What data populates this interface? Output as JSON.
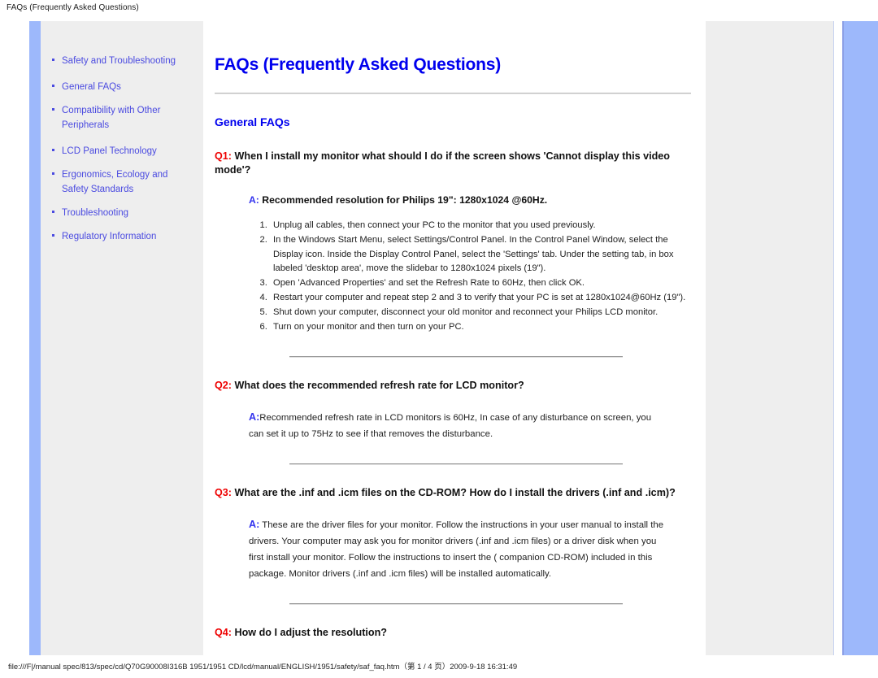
{
  "window": {
    "title": "FAQs (Frequently Asked Questions)"
  },
  "sidebar": {
    "items": [
      {
        "label": "Safety and Troubleshooting"
      },
      {
        "label": "General FAQs"
      },
      {
        "label": "Compatibility with Other Peripherals"
      },
      {
        "label": "LCD Panel Technology"
      },
      {
        "label": "Ergonomics, Ecology and Safety Standards"
      },
      {
        "label": "Troubleshooting"
      },
      {
        "label": "Regulatory Information"
      }
    ]
  },
  "main": {
    "page_title": "FAQs (Frequently Asked Questions)",
    "section_title": "General FAQs",
    "questions": [
      {
        "tag": "Q1:",
        "text": "When I install my monitor what should I do if the screen shows 'Cannot display this video mode'?",
        "answer_tag": "A:",
        "answer_head": "Recommended resolution for Philips 19\": 1280x1024 @60Hz.",
        "steps": [
          "Unplug all cables, then connect your PC to the monitor that you used previously.",
          "In the Windows Start Menu, select Settings/Control Panel. In the Control Panel Window, select the Display icon. Inside the Display Control Panel, select the 'Settings' tab. Under the setting tab, in box labeled 'desktop area', move the slidebar to 1280x1024 pixels (19\").",
          "Open 'Advanced Properties' and set the Refresh Rate to 60Hz, then click OK.",
          "Restart your computer and repeat step 2 and 3 to verify that your PC is set at 1280x1024@60Hz (19\").",
          "Shut down your computer, disconnect your old monitor and reconnect your Philips LCD monitor.",
          "Turn on your monitor and then turn on your PC."
        ]
      },
      {
        "tag": "Q2:",
        "text": "What does the recommended refresh rate for LCD monitor?",
        "answer_tag": "A:",
        "answer_body": "Recommended refresh rate in LCD monitors is 60Hz, In case of any disturbance on screen, you can set it up to 75Hz to see if that removes the disturbance."
      },
      {
        "tag": "Q3:",
        "text": "What are the .inf and .icm files on the CD-ROM? How do I install the drivers (.inf and .icm)?",
        "answer_tag": "A:",
        "answer_body": "These are the driver files for your monitor. Follow the instructions in your user manual to install the drivers. Your computer may ask you for monitor drivers (.inf and .icm files) or a driver disk when you first install your monitor. Follow the instructions to insert the ( companion CD-ROM) included in this package. Monitor drivers (.inf and .icm files) will be installed automatically."
      },
      {
        "tag": "Q4:",
        "text": "How do I adjust the resolution?"
      }
    ]
  },
  "status_bar": {
    "text": "file:///F|/manual spec/813/spec/cd/Q70G90008I316B 1951/1951 CD/lcd/manual/ENGLISH/1951/safety/saf_faq.htm（第 1 / 4 页）2009-9-18 16:31:49"
  },
  "colors": {
    "link": "#4a4ae0",
    "heading": "#0000ee",
    "question_tag": "#ee0000",
    "answer_tag": "#3333ee",
    "panel_bg": "#eeeeee",
    "accent_bar": "#9db8fb"
  }
}
